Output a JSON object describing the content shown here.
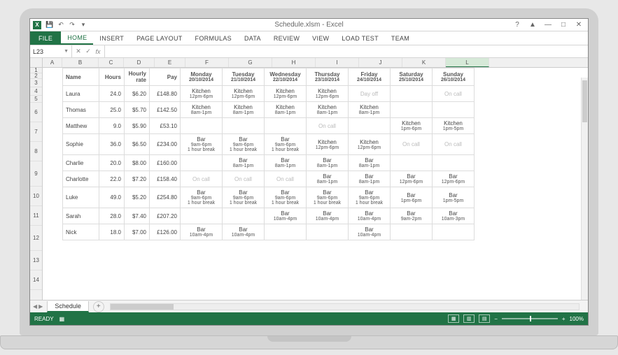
{
  "window": {
    "title": "Schedule.xlsm - Excel",
    "help": "?",
    "ribbon_toggle": "▲",
    "minimize": "—",
    "maximize": "□",
    "close": "✕"
  },
  "qat": {
    "save": "💾",
    "undo": "↶",
    "redo": "↷",
    "dropdown": "▾"
  },
  "ribbon": {
    "tabs": [
      "FILE",
      "HOME",
      "INSERT",
      "PAGE LAYOUT",
      "FORMULAS",
      "DATA",
      "REVIEW",
      "VIEW",
      "LOAD TEST",
      "TEAM"
    ],
    "active": "HOME"
  },
  "namebox": {
    "value": "L23"
  },
  "formula": {
    "cancel": "✕",
    "enter": "✓",
    "fx": "fx",
    "value": ""
  },
  "columns": [
    "A",
    "B",
    "C",
    "D",
    "E",
    "F",
    "G",
    "H",
    "I",
    "J",
    "K",
    "L"
  ],
  "selected_col": "L",
  "rows": [
    "1",
    "2",
    "3",
    "4",
    "5",
    "6",
    "7",
    "8",
    "9",
    "10",
    "11",
    "12",
    "13",
    "14"
  ],
  "headers": {
    "name": "Name",
    "hours": "Hours",
    "rate": "Hourly rate",
    "pay": "Pay",
    "days": [
      {
        "dow": "Monday",
        "date": "20/10/2014"
      },
      {
        "dow": "Tuesday",
        "date": "21/10/2014"
      },
      {
        "dow": "Wednesday",
        "date": "22/10/2014"
      },
      {
        "dow": "Thursday",
        "date": "23/10/2014"
      },
      {
        "dow": "Friday",
        "date": "24/10/2014"
      },
      {
        "dow": "Saturday",
        "date": "25/10/2014"
      },
      {
        "dow": "Sunday",
        "date": "26/10/2014"
      }
    ]
  },
  "employees": [
    {
      "name": "Laura",
      "hours": "24.0",
      "rate": "$6.20",
      "pay": "£148.80",
      "shifts": [
        {
          "t": "Kitchen",
          "h": "12pm-6pm"
        },
        {
          "t": "Kitchen",
          "h": "12pm-6pm"
        },
        {
          "t": "Kitchen",
          "h": "12pm-6pm"
        },
        {
          "t": "Kitchen",
          "h": "12pm-6pm"
        },
        {
          "t": "Day off",
          "mute": true
        },
        {
          "t": ""
        },
        {
          "t": "On call",
          "mute": true
        }
      ]
    },
    {
      "name": "Thomas",
      "hours": "25.0",
      "rate": "$5.70",
      "pay": "£142.50",
      "shifts": [
        {
          "t": "Kitchen",
          "h": "8am-1pm"
        },
        {
          "t": "Kitchen",
          "h": "8am-1pm"
        },
        {
          "t": "Kitchen",
          "h": "8am-1pm"
        },
        {
          "t": "Kitchen",
          "h": "8am-1pm"
        },
        {
          "t": "Kitchen",
          "h": "8am-1pm"
        },
        {
          "t": ""
        },
        {
          "t": ""
        }
      ]
    },
    {
      "name": "Matthew",
      "hours": "9.0",
      "rate": "$5.90",
      "pay": "£53.10",
      "shifts": [
        {
          "t": ""
        },
        {
          "t": ""
        },
        {
          "t": ""
        },
        {
          "t": "On call",
          "mute": true
        },
        {
          "t": ""
        },
        {
          "t": "Kitchen",
          "h": "1pm-6pm"
        },
        {
          "t": "Kitchen",
          "h": "1pm-5pm"
        }
      ]
    },
    {
      "name": "Sophie",
      "hours": "36.0",
      "rate": "$6.50",
      "pay": "£234.00",
      "shifts": [
        {
          "t": "Bar",
          "h": "9am-6pm",
          "b": "1 hour break"
        },
        {
          "t": "Bar",
          "h": "9am-6pm",
          "b": "1 hour break"
        },
        {
          "t": "Bar",
          "h": "9am-6pm",
          "b": "1 hour break"
        },
        {
          "t": "Kitchen",
          "h": "12pm-6pm"
        },
        {
          "t": "Kitchen",
          "h": "12pm-6pm"
        },
        {
          "t": "On call",
          "mute": true
        },
        {
          "t": "On call",
          "mute": true
        }
      ]
    },
    {
      "name": "Charlie",
      "hours": "20.0",
      "rate": "$8.00",
      "pay": "£160.00",
      "shifts": [
        {
          "t": ""
        },
        {
          "t": "Bar",
          "h": "8am-1pm"
        },
        {
          "t": "Bar",
          "h": "8am-1pm"
        },
        {
          "t": "Bar",
          "h": "8am-1pm"
        },
        {
          "t": "Bar",
          "h": "8am-1pm"
        },
        {
          "t": ""
        },
        {
          "t": ""
        }
      ]
    },
    {
      "name": "Charlotte",
      "hours": "22.0",
      "rate": "$7.20",
      "pay": "£158.40",
      "shifts": [
        {
          "t": "On call",
          "mute": true
        },
        {
          "t": "On call",
          "mute": true
        },
        {
          "t": "On call",
          "mute": true
        },
        {
          "t": "Bar",
          "h": "8am-1pm"
        },
        {
          "t": "Bar",
          "h": "8am-1pm"
        },
        {
          "t": "Bar",
          "h": "12pm-6pm"
        },
        {
          "t": "Bar",
          "h": "12pm-6pm"
        }
      ]
    },
    {
      "name": "Luke",
      "hours": "49.0",
      "rate": "$5.20",
      "pay": "£254.80",
      "shifts": [
        {
          "t": "Bar",
          "h": "9am-6pm",
          "b": "1 hour break"
        },
        {
          "t": "Bar",
          "h": "9am-6pm",
          "b": "1 hour break"
        },
        {
          "t": "Bar",
          "h": "9am-6pm",
          "b": "1 hour break"
        },
        {
          "t": "Bar",
          "h": "9am-6pm",
          "b": "1 hour break"
        },
        {
          "t": "Bar",
          "h": "9am-6pm",
          "b": "1 hour break"
        },
        {
          "t": "Bar",
          "h": "1pm-6pm"
        },
        {
          "t": "Bar",
          "h": "1pm-5pm"
        }
      ]
    },
    {
      "name": "Sarah",
      "hours": "28.0",
      "rate": "$7.40",
      "pay": "£207.20",
      "shifts": [
        {
          "t": ""
        },
        {
          "t": ""
        },
        {
          "t": "Bar",
          "h": "10am-4pm"
        },
        {
          "t": "Bar",
          "h": "10am-4pm"
        },
        {
          "t": "Bar",
          "h": "10am-4pm"
        },
        {
          "t": "Bar",
          "h": "9am-2pm"
        },
        {
          "t": "Bar",
          "h": "10am-3pm"
        }
      ]
    },
    {
      "name": "Nick",
      "hours": "18.0",
      "rate": "$7.00",
      "pay": "£126.00",
      "shifts": [
        {
          "t": "Bar",
          "h": "10am-4pm"
        },
        {
          "t": "Bar",
          "h": "10am-4pm"
        },
        {
          "t": ""
        },
        {
          "t": ""
        },
        {
          "t": "Bar",
          "h": "10am-4pm"
        },
        {
          "t": ""
        },
        {
          "t": ""
        }
      ]
    }
  ],
  "sheettab": {
    "name": "Schedule",
    "add": "+"
  },
  "status": {
    "ready": "READY",
    "zoom": "100%",
    "minus": "−",
    "plus": "+"
  }
}
